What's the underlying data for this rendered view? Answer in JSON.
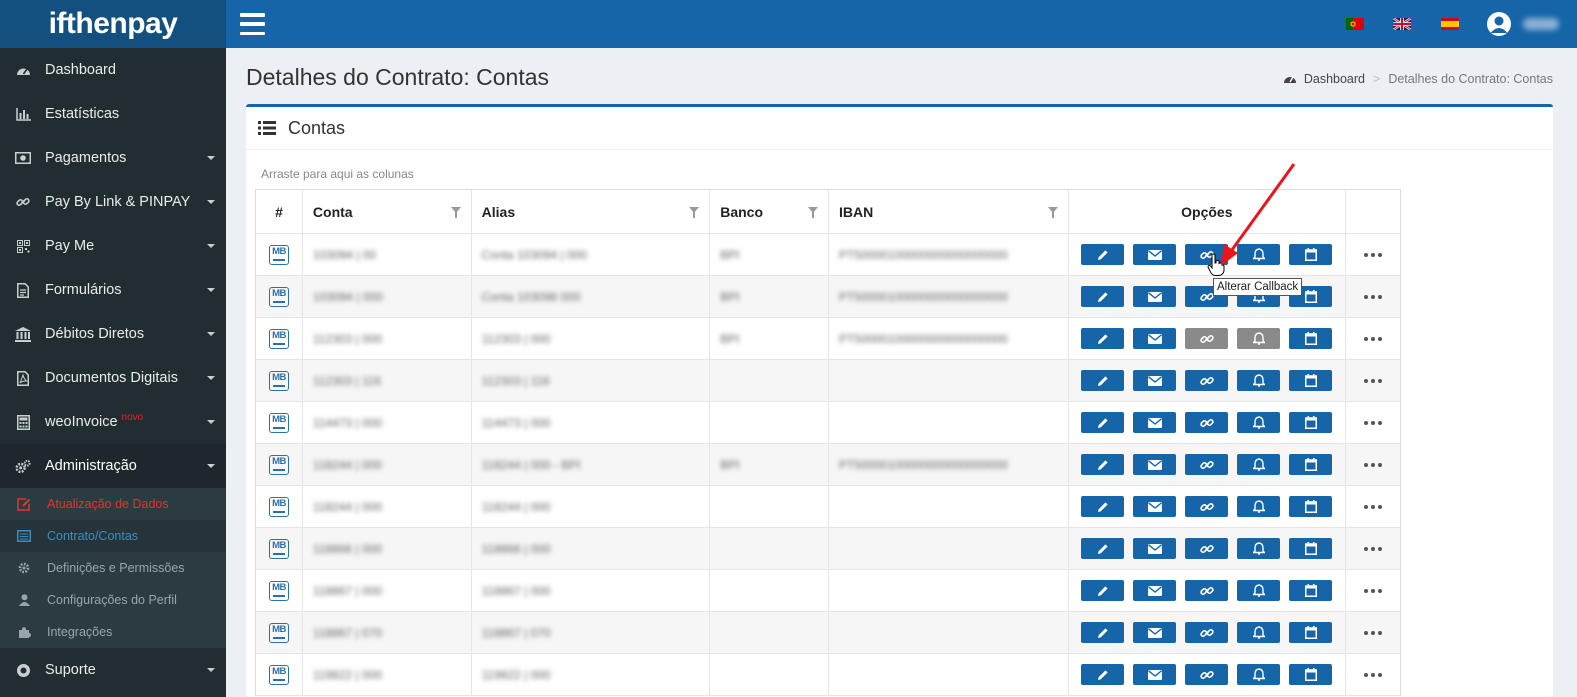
{
  "app": {
    "logo_text": "ifthenpay"
  },
  "header": {
    "flags": [
      "pt-flag-icon",
      "uk-flag-icon",
      "es-flag-icon"
    ],
    "user_icon": "user-avatar-icon"
  },
  "sidebar": {
    "items": [
      {
        "label": "Dashboard",
        "icon": "dashboard-icon",
        "caret": false
      },
      {
        "label": "Estatísticas",
        "icon": "bar-chart-icon",
        "caret": false
      },
      {
        "label": "Pagamentos",
        "icon": "money-icon",
        "caret": true
      },
      {
        "label": "Pay By Link & PINPAY",
        "icon": "link-icon",
        "caret": true
      },
      {
        "label": "Pay Me",
        "icon": "qrcode-icon",
        "caret": true
      },
      {
        "label": "Formulários",
        "icon": "file-text-icon",
        "caret": true
      },
      {
        "label": "Débitos Diretos",
        "icon": "bank-icon",
        "caret": true
      },
      {
        "label": "Documentos Digitais",
        "icon": "pdf-icon",
        "caret": true
      },
      {
        "label": "weoInvoice",
        "badge": "novo",
        "icon": "calculator-icon",
        "caret": true
      },
      {
        "label": "Administração",
        "icon": "cogs-icon",
        "caret": true,
        "active": true
      }
    ],
    "subitems": [
      {
        "label": "Atualização de Dados",
        "icon": "edit-icon",
        "style": "red"
      },
      {
        "label": "Contrato/Contas",
        "icon": "list-alt-icon",
        "style": "current"
      },
      {
        "label": "Definições e Permissões",
        "icon": "gear-icon"
      },
      {
        "label": "Configurações do Perfil",
        "icon": "user-icon"
      },
      {
        "label": "Integrações",
        "icon": "puzzle-icon"
      }
    ],
    "footer_item": {
      "label": "Suporte",
      "icon": "life-ring-icon",
      "caret": true
    }
  },
  "page": {
    "title": "Detalhes do Contrato: Contas",
    "breadcrumb": {
      "home": "Dashboard",
      "current": "Detalhes do Contrato: Contas"
    }
  },
  "box": {
    "title": "Contas",
    "group_hint": "Arraste para aqui as colunas"
  },
  "table": {
    "columns": [
      "#",
      "Conta",
      "Alias",
      "Banco",
      "IBAN",
      "Opções"
    ],
    "row_logo": "MB",
    "rows": [
      {
        "conta": "103094 | 00",
        "alias": "Conta 103094 | 000",
        "banco": "BPI",
        "iban": "PT50000100000000000000000",
        "disabled": []
      },
      {
        "conta": "103094 | 000",
        "alias": "Conta 103098 000",
        "banco": "BPI",
        "iban": "PT50000100000000000000000",
        "disabled": []
      },
      {
        "conta": "112303 | 000",
        "alias": "112303 | 000",
        "banco": "BPI",
        "iban": "PT50000100000000000000000",
        "disabled": [
          "callback",
          "notify"
        ]
      },
      {
        "conta": "112303 | 116",
        "alias": "112303 | 116",
        "banco": "",
        "iban": "",
        "disabled": []
      },
      {
        "conta": "114473 | 000",
        "alias": "114473 | 000",
        "banco": "",
        "iban": "",
        "disabled": []
      },
      {
        "conta": "118244 | 000",
        "alias": "118244 | 000 - BPI",
        "banco": "BPI",
        "iban": "PT50000100000000000000000",
        "disabled": []
      },
      {
        "conta": "118244 | 000",
        "alias": "118244 | 000",
        "banco": "",
        "iban": "",
        "disabled": []
      },
      {
        "conta": "118866 | 000",
        "alias": "118866 | 000",
        "banco": "",
        "iban": "",
        "disabled": []
      },
      {
        "conta": "118867 | 000",
        "alias": "118867 | 000",
        "banco": "",
        "iban": "",
        "disabled": []
      },
      {
        "conta": "118867 | 070",
        "alias": "118867 | 070",
        "banco": "",
        "iban": "",
        "disabled": []
      },
      {
        "conta": "119822 | 000",
        "alias": "119822 | 000",
        "banco": "",
        "iban": "",
        "disabled": []
      }
    ],
    "option_buttons": [
      "edit-icon",
      "envelope-icon",
      "link-icon",
      "bell-icon",
      "calendar-icon"
    ]
  },
  "tooltip": {
    "text": "Alterar Callback"
  },
  "colors": {
    "primary": "#1565a8",
    "sidebar": "#222d32",
    "disabled": "#8a8a8a",
    "annotation": "#e8151b"
  }
}
